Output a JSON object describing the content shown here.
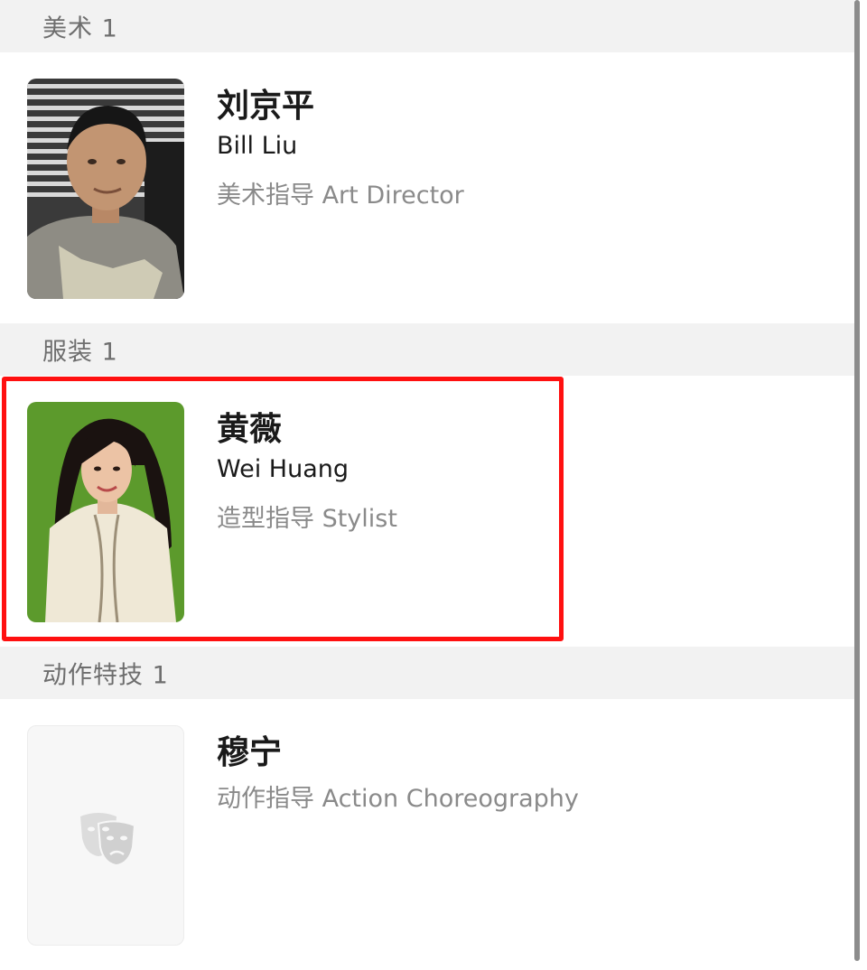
{
  "sections": [
    {
      "header": "美术 1",
      "people": [
        {
          "name_cn": "刘京平",
          "name_en": "Bill Liu",
          "role": "美术指导 Art Director",
          "photo_icon": "person-photo"
        }
      ]
    },
    {
      "header": "服装 1",
      "people": [
        {
          "name_cn": "黄薇",
          "name_en": "Wei Huang",
          "role": "造型指导 Stylist",
          "photo_icon": "person-photo"
        }
      ]
    },
    {
      "header": "动作特技 1",
      "people": [
        {
          "name_cn": "穆宁",
          "role": "动作指导 Action Choreography",
          "photo_icon": "theater-masks-icon"
        }
      ]
    }
  ],
  "colors": {
    "highlight": "#ff1010",
    "section_bg": "#f2f2f2",
    "secondary_text": "#8a8a8a"
  }
}
